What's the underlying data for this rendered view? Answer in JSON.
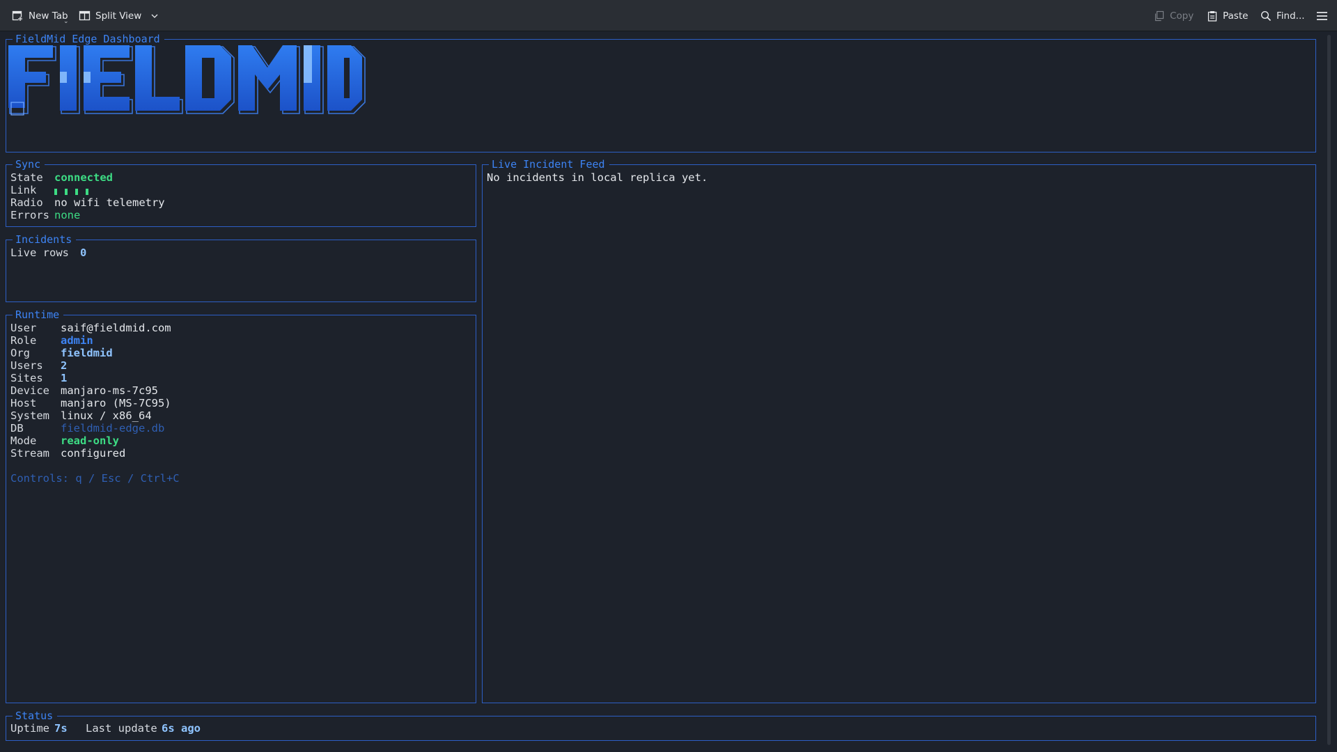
{
  "toolbar": {
    "new_tab": "New Tab",
    "split_view": "Split View",
    "copy": "Copy",
    "paste": "Paste",
    "find": "Find..."
  },
  "header": {
    "title": "FieldMid Edge Dashboard",
    "logo_text": "FIELDMID"
  },
  "sync": {
    "title": "Sync",
    "rows": [
      {
        "label": "State",
        "value": "connected"
      },
      {
        "label": "Link",
        "value": "▮▮▮▮"
      },
      {
        "label": "Radio",
        "value": "no wifi telemetry"
      },
      {
        "label": "Errors",
        "value": "none"
      }
    ]
  },
  "incidents": {
    "title": "Incidents",
    "live_rows_label": "Live rows",
    "live_rows_value": "0"
  },
  "runtime": {
    "title": "Runtime",
    "rows": [
      {
        "label": "User",
        "value": "saif@fieldmid.com"
      },
      {
        "label": "Role",
        "value": "admin"
      },
      {
        "label": "Org",
        "value": "fieldmid"
      },
      {
        "label": "Users",
        "value": "2"
      },
      {
        "label": "Sites",
        "value": "1"
      },
      {
        "label": "Device",
        "value": "manjaro-ms-7c95"
      },
      {
        "label": "Host",
        "value": "manjaro (MS-7C95)"
      },
      {
        "label": "System",
        "value": "linux / x86_64"
      },
      {
        "label": "DB",
        "value": "fieldmid-edge.db"
      },
      {
        "label": "Mode",
        "value": "read-only"
      },
      {
        "label": "Stream",
        "value": "configured"
      }
    ],
    "controls": "Controls: q / Esc / Ctrl+C"
  },
  "feed": {
    "title": "Live Incident Feed",
    "empty_message": "No incidents in local replica yet."
  },
  "status": {
    "title": "Status",
    "uptime_label": "Uptime",
    "uptime_value": "7s",
    "last_update_label": "Last update",
    "last_update_value": "6s ago"
  },
  "colors": {
    "accent": "#3d84f5",
    "border": "#2d5fc6",
    "success": "#3ddc84",
    "background": "#1d222b",
    "toolbar": "#2a2e34"
  },
  "icons": [
    "new-tab-icon",
    "split-view-icon",
    "chevron-down-icon",
    "copy-icon",
    "paste-icon",
    "search-icon",
    "hamburger-menu-icon"
  ]
}
